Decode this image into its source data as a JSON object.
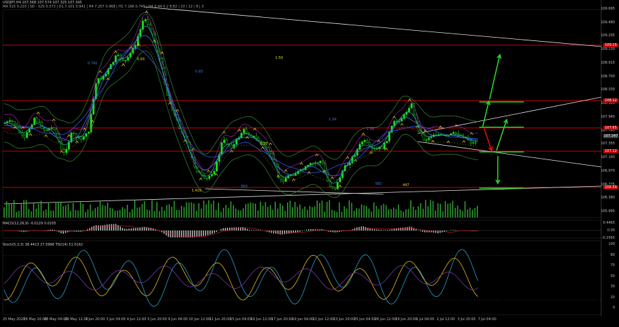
{
  "header": {
    "symbol_line": "USDJPY,H4  107.568 107.574 107.325 107.345",
    "indicator_line": "MA  515  0.220 | SD  -  S2S   0.373 | D1.7.101   0.941 | H4 7.207   0.968 | H1 7.166   0.745 | H4 0.44  0.2 8.82 | 10 | 12 | 8 | 3"
  },
  "price_axis": {
    "labels": [
      "109.695",
      "109.480",
      "109.205",
      "109.130",
      "108.915",
      "108.700",
      "108.330",
      "108.120",
      "107.940",
      "107.745",
      "107.355",
      "107.160",
      "106.970",
      "106.775",
      "106.380",
      "105.995"
    ],
    "tags": [
      {
        "text": "109.15",
        "color": "#c00000"
      },
      {
        "text": "108.12",
        "color": "#c00000"
      },
      {
        "text": "107.65",
        "color": "#c00000"
      },
      {
        "text": "107.347",
        "color": "#3d3d3d"
      },
      {
        "text": "107.12",
        "color": "#c00000"
      },
      {
        "text": "106.59",
        "color": "#c00000"
      }
    ]
  },
  "macd": {
    "label": "MACD(12,26,9)  -0.0129  0.0205",
    "axis": [
      "0.4465",
      "0.00",
      "-0.2565"
    ]
  },
  "stoch": {
    "label": "Stoch(5,3,3)  38.4413  27.0996  TSI(14)  51.0162",
    "axis": [
      "100",
      "80",
      "70",
      "50",
      "30",
      "20",
      "0"
    ]
  },
  "time_axis": [
    "25 May 2020",
    "26 May 20:00",
    "28 May 04:00",
    "29 May 12:00",
    "1 Jun 20:00",
    "3 Jun 04:00",
    "4 Jun 12:00",
    "5 Jun 20:00",
    "9 Jun 04:00",
    "10 Jun 12:00",
    "11 Jun 20:00",
    "15 Jun 04:00",
    "16 Jun 12:00",
    "17 Jun 20:00",
    "19 Jun 04:00",
    "22 Jun 12:00",
    "23 Jun 20:00",
    "25 Jun 04:00",
    "26 Jun 12:00",
    "29 Jun 20:00",
    "1 Jul 04:00",
    "2 Jul 12:00",
    "3 Jul 20:00",
    "7 Jul 04:00"
  ],
  "annotations": [
    "0.742",
    "0.93",
    "0.93",
    "1.50",
    "1.34",
    "1.416",
    "800",
    "0.97",
    "582",
    "447",
    "1.58"
  ],
  "colors": {
    "bull": "#1fdc1f",
    "bear": "#1fdc1f",
    "level": "#d00000",
    "trend": "#e6e6e6",
    "signal": "#e8e020",
    "arrow_green": "#29d629",
    "arrow_red": "#e01010"
  }
}
